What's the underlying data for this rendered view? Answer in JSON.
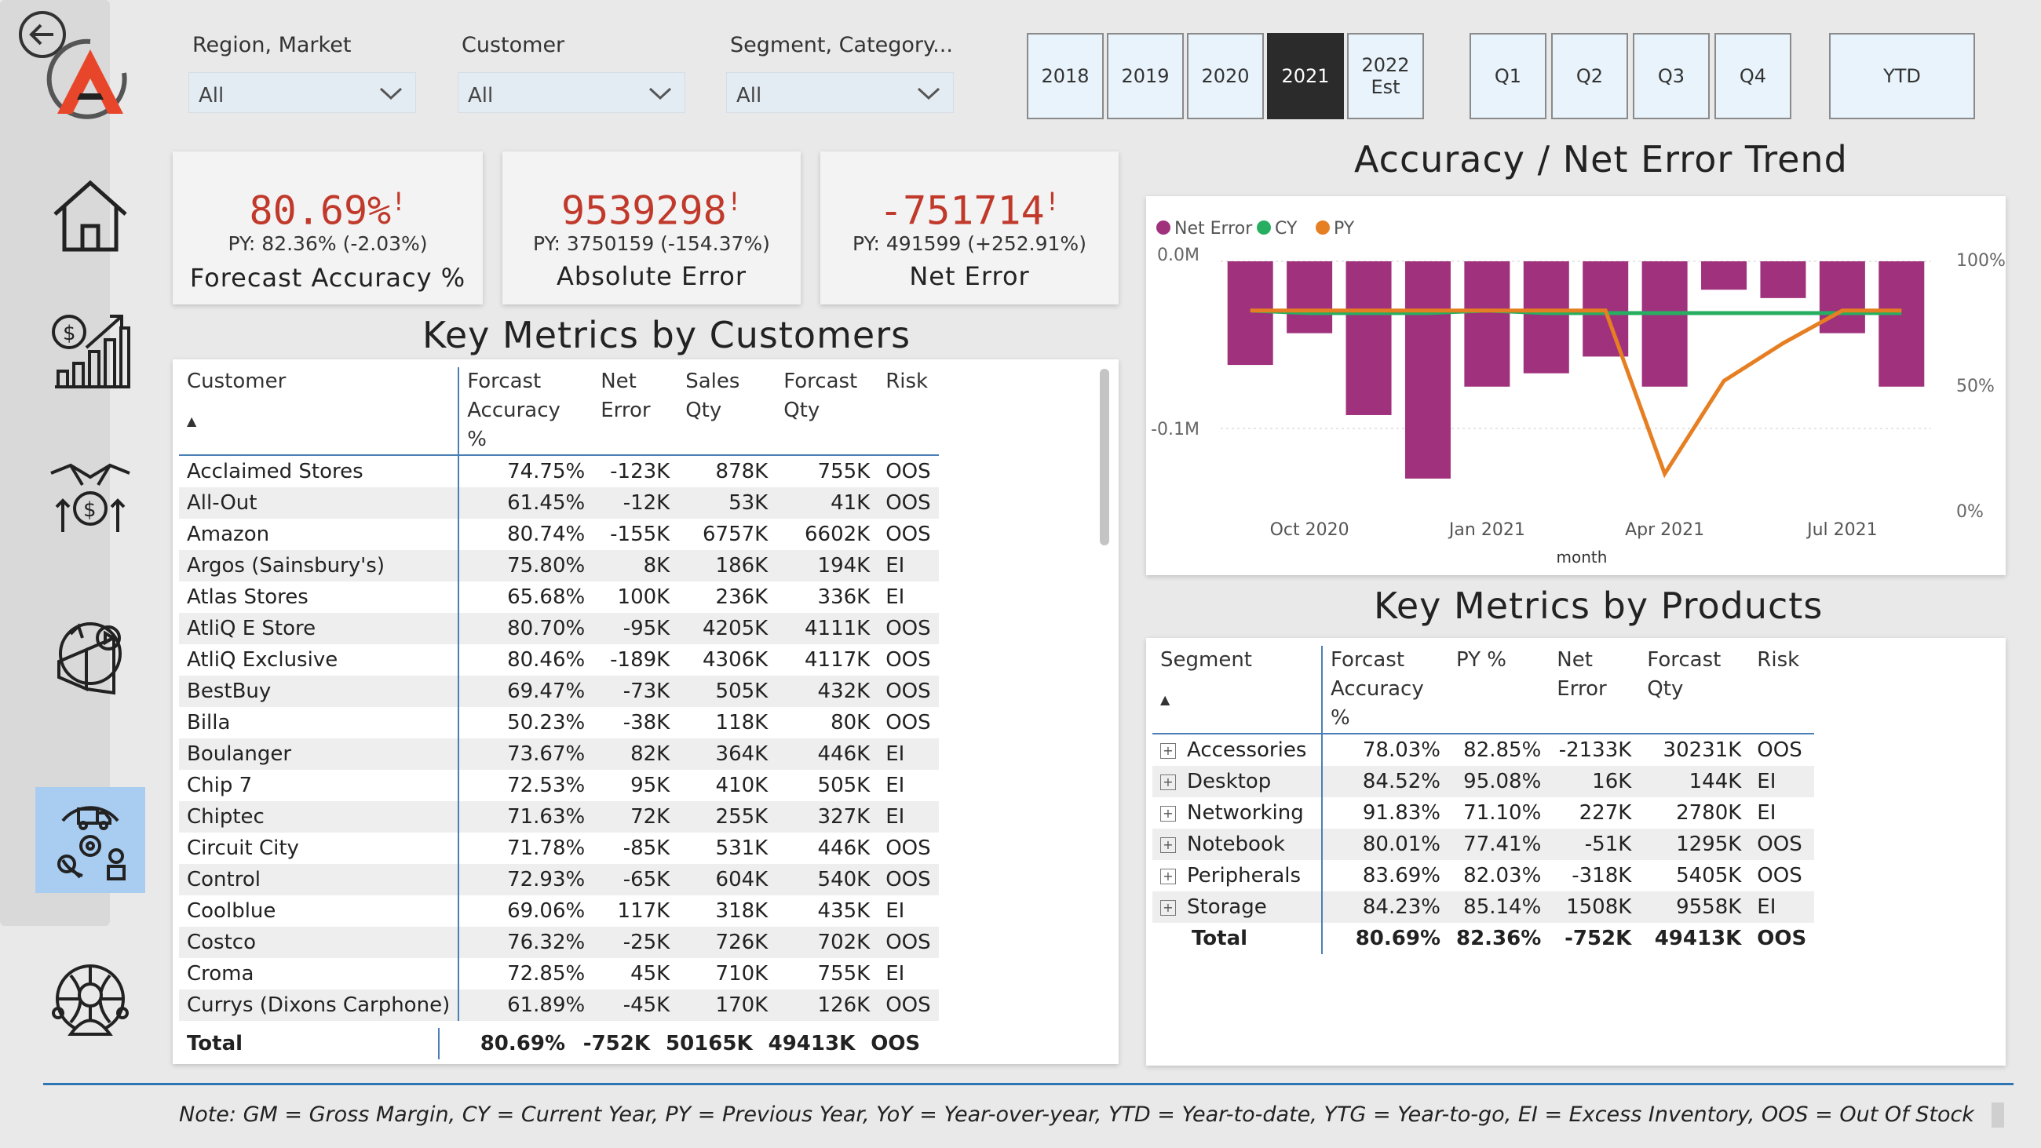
{
  "filters": [
    {
      "label": "Region, Market",
      "value": "All"
    },
    {
      "label": "Customer",
      "value": "All"
    },
    {
      "label": "Segment, Category...",
      "value": "All"
    }
  ],
  "years": [
    {
      "label": "2018",
      "selected": false
    },
    {
      "label": "2019",
      "selected": false
    },
    {
      "label": "2020",
      "selected": false
    },
    {
      "label": "2021",
      "selected": true
    },
    {
      "label": "2022 Est",
      "selected": false
    }
  ],
  "quarters": [
    "Q1",
    "Q2",
    "Q3",
    "Q4"
  ],
  "ytd_label": "YTD",
  "kpis": [
    {
      "value": "80.69%",
      "flag": "!",
      "py": "PY: 82.36% (-2.03%)",
      "label": "Forecast Accuracy %"
    },
    {
      "value": "9539298",
      "flag": "!",
      "py": "PY: 3750159 (-154.37%)",
      "label": "Absolute Error"
    },
    {
      "value": "-751714",
      "flag": "!",
      "py": "PY: 491599 (+252.91%)",
      "label": "Net Error"
    }
  ],
  "customers_table": {
    "title": "Key Metrics by Customers",
    "columns": [
      {
        "line1": "Customer",
        "line2": ""
      },
      {
        "line1": "Forcast",
        "line2": "Accuracy %"
      },
      {
        "line1": "Net",
        "line2": "Error"
      },
      {
        "line1": "Sales",
        "line2": "Qty"
      },
      {
        "line1": "Forcast",
        "line2": "Qty"
      },
      {
        "line1": "Risk",
        "line2": ""
      }
    ],
    "rows": [
      [
        "Acclaimed Stores",
        "74.75%",
        "-123K",
        "878K",
        "755K",
        "OOS"
      ],
      [
        "All-Out",
        "61.45%",
        "-12K",
        "53K",
        "41K",
        "OOS"
      ],
      [
        "Amazon",
        "80.74%",
        "-155K",
        "6757K",
        "6602K",
        "OOS"
      ],
      [
        "Argos (Sainsbury's)",
        "75.80%",
        "8K",
        "186K",
        "194K",
        "EI"
      ],
      [
        "Atlas Stores",
        "65.68%",
        "100K",
        "236K",
        "336K",
        "EI"
      ],
      [
        "AtliQ E Store",
        "80.70%",
        "-95K",
        "4205K",
        "4111K",
        "OOS"
      ],
      [
        "AtliQ Exclusive",
        "80.46%",
        "-189K",
        "4306K",
        "4117K",
        "OOS"
      ],
      [
        "BestBuy",
        "69.47%",
        "-73K",
        "505K",
        "432K",
        "OOS"
      ],
      [
        "Billa",
        "50.23%",
        "-38K",
        "118K",
        "80K",
        "OOS"
      ],
      [
        "Boulanger",
        "73.67%",
        "82K",
        "364K",
        "446K",
        "EI"
      ],
      [
        "Chip 7",
        "72.53%",
        "95K",
        "410K",
        "505K",
        "EI"
      ],
      [
        "Chiptec",
        "71.63%",
        "72K",
        "255K",
        "327K",
        "EI"
      ],
      [
        "Circuit City",
        "71.78%",
        "-85K",
        "531K",
        "446K",
        "OOS"
      ],
      [
        "Control",
        "72.93%",
        "-65K",
        "604K",
        "540K",
        "OOS"
      ],
      [
        "Coolblue",
        "69.06%",
        "117K",
        "318K",
        "435K",
        "EI"
      ],
      [
        "Costco",
        "76.32%",
        "-25K",
        "726K",
        "702K",
        "OOS"
      ],
      [
        "Croma",
        "72.85%",
        "45K",
        "710K",
        "755K",
        "EI"
      ],
      [
        "Currys (Dixons Carphone)",
        "61.89%",
        "-45K",
        "170K",
        "126K",
        "OOS"
      ]
    ],
    "total": [
      "Total",
      "80.69%",
      "-752K",
      "50165K",
      "49413K",
      "OOS"
    ]
  },
  "trend_chart": {
    "title": "Accuracy / Net Error Trend",
    "legend": [
      "Net Error",
      "CY",
      "PY"
    ],
    "xlabel": "month",
    "left_ticks": [
      "0.0M",
      "-0.1M"
    ],
    "right_ticks": [
      "100%",
      "50%",
      "0%"
    ],
    "x_ticks": [
      "Oct 2020",
      "Jan 2021",
      "Apr 2021",
      "Jul 2021"
    ]
  },
  "chart_data": {
    "type": "bar",
    "categories": [
      "Sep 2020",
      "Oct 2020",
      "Nov 2020",
      "Dec 2020",
      "Jan 2021",
      "Feb 2021",
      "Mar 2021",
      "Apr 2021",
      "May 2021",
      "Jun 2021",
      "Jul 2021",
      "Aug 2021"
    ],
    "series": [
      {
        "name": "Net Error",
        "type": "bar",
        "axis": "left",
        "values": [
          -0.062,
          -0.043,
          -0.092,
          -0.13,
          -0.075,
          -0.067,
          -0.057,
          -0.075,
          -0.017,
          -0.022,
          -0.043,
          -0.075
        ]
      },
      {
        "name": "CY",
        "type": "line",
        "axis": "right",
        "values": [
          81,
          80,
          80,
          80,
          81,
          80,
          80,
          80,
          80,
          80,
          80,
          80
        ]
      },
      {
        "name": "PY",
        "type": "line",
        "axis": "right",
        "values": [
          81,
          81,
          81,
          81,
          81,
          81,
          81,
          16,
          53,
          68,
          81,
          81
        ]
      }
    ],
    "title": "Accuracy / Net Error Trend",
    "xlabel": "month",
    "ylim_left": [
      -0.15,
      0
    ],
    "ylim_right": [
      0,
      100
    ],
    "colors": {
      "Net Error": "#a0317d",
      "CY": "#27ae60",
      "PY": "#e67e22"
    },
    "legend": "top-left",
    "grid": true
  },
  "products_table": {
    "title": "Key Metrics by Products",
    "columns": [
      {
        "line1": "Segment",
        "line2": ""
      },
      {
        "line1": "Forcast",
        "line2": "Accuracy %"
      },
      {
        "line1": "PY %",
        "line2": ""
      },
      {
        "line1": "Net",
        "line2": "Error"
      },
      {
        "line1": "Forcast",
        "line2": "Qty"
      },
      {
        "line1": "Risk",
        "line2": ""
      }
    ],
    "rows": [
      [
        "Accessories",
        "78.03%",
        "82.85%",
        "-2133K",
        "30231K",
        "OOS"
      ],
      [
        "Desktop",
        "84.52%",
        "95.08%",
        "16K",
        "144K",
        "EI"
      ],
      [
        "Networking",
        "91.83%",
        "71.10%",
        "227K",
        "2780K",
        "EI"
      ],
      [
        "Notebook",
        "80.01%",
        "77.41%",
        "-51K",
        "1295K",
        "OOS"
      ],
      [
        "Peripherals",
        "83.69%",
        "82.03%",
        "-318K",
        "5405K",
        "OOS"
      ],
      [
        "Storage",
        "84.23%",
        "85.14%",
        "1508K",
        "9558K",
        "EI"
      ]
    ],
    "total": [
      "Total",
      "80.69%",
      "82.36%",
      "-752K",
      "49413K",
      "OOS"
    ]
  },
  "note": "Note: GM = Gross Margin, CY = Current Year, PY = Previous Year, YoY = Year-over-year, YTD = Year-to-date, YTG = Year-to-go, EI = Excess Inventory, OOS = Out Of Stock",
  "nav_icons": [
    "home-icon",
    "finance-growth-icon",
    "sales-handshake-icon",
    "marketing-icon",
    "supply-chain-icon",
    "executive-icon"
  ],
  "colors": {
    "accent": "#c0392b",
    "selected": "#2b2b2b",
    "nav_active": "#a9cdf0",
    "divider": "#2e75b6"
  }
}
